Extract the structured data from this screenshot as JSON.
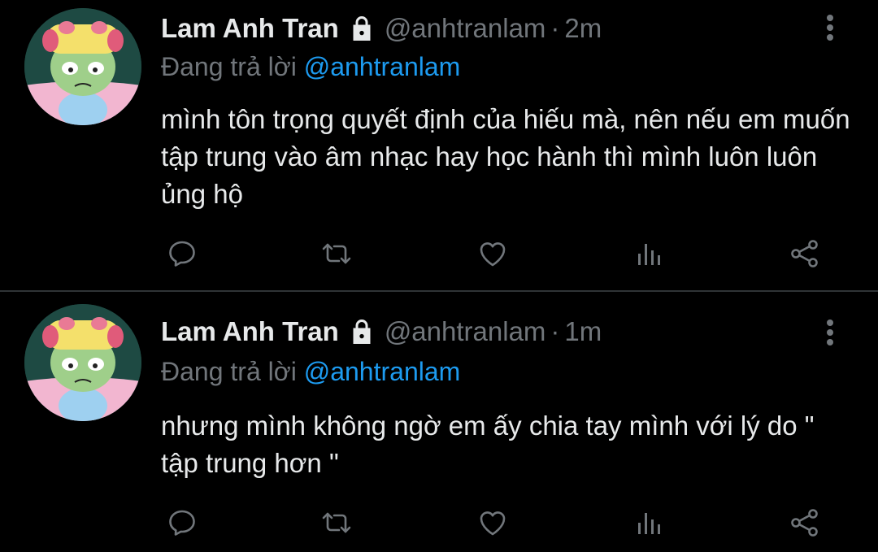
{
  "tweets": [
    {
      "name": "Lam Anh Tran",
      "handle": "@anhtranlam",
      "separator": "·",
      "time": "2m",
      "reply_prefix": "Đang trả lời",
      "reply_to": "@anhtranlam",
      "text": "mình tôn trọng quyết định của hiếu mà, nên nếu em muốn tập trung vào âm nhạc hay học hành thì mình luôn luôn ủng hộ"
    },
    {
      "name": "Lam Anh Tran",
      "handle": "@anhtranlam",
      "separator": "·",
      "time": "1m",
      "reply_prefix": "Đang trả lời",
      "reply_to": "@anhtranlam",
      "text": "nhưng mình không ngờ em ấy chia tay mình với lý do \" tập trung hơn \""
    }
  ],
  "icons": {
    "lock": "lock-icon",
    "more": "more-vertical-icon",
    "actions": [
      "reply-icon",
      "retweet-icon",
      "like-icon",
      "analytics-icon",
      "share-icon"
    ]
  },
  "colors": {
    "background": "#000000",
    "text": "#e7e9ea",
    "muted": "#71767b",
    "link": "#1d9bf0",
    "divider": "#2f3336"
  }
}
